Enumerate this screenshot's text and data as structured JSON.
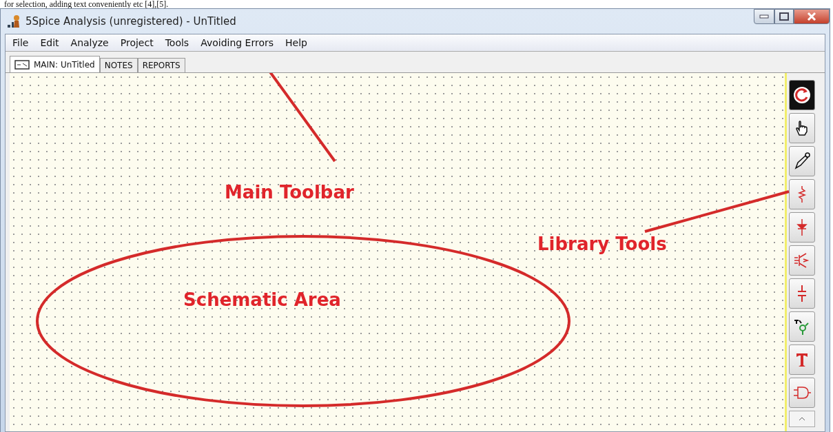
{
  "page_text": "for selection, adding text conveniently etc [4],[5].",
  "window": {
    "title": "5Spice Analysis (unregistered) - UnTitled"
  },
  "menu": [
    "File",
    "Edit",
    "Analyze",
    "Project",
    "Tools",
    "Avoiding Errors",
    "Help"
  ],
  "tabs": [
    {
      "label": "MAIN:  UnTitled",
      "selected": true
    },
    {
      "label": "NOTES",
      "selected": false
    },
    {
      "label": "REPORTS",
      "selected": false
    }
  ],
  "tools": [
    {
      "kind": "refresh",
      "selected": true
    },
    {
      "kind": "hand",
      "selected": false
    },
    {
      "kind": "probe",
      "selected": false
    },
    {
      "kind": "resistor",
      "selected": false
    },
    {
      "kind": "diode",
      "selected": false
    },
    {
      "kind": "transistor",
      "selected": false
    },
    {
      "kind": "capacitor",
      "selected": false
    },
    {
      "kind": "node",
      "selected": false
    },
    {
      "kind": "text",
      "selected": false
    },
    {
      "kind": "gate",
      "selected": false
    },
    {
      "kind": "scroll",
      "selected": false
    }
  ],
  "annotations": [
    {
      "kind": "arrow",
      "label": "Main Toolbar"
    },
    {
      "kind": "arrow",
      "label": "Library Tools"
    },
    {
      "kind": "ellipse",
      "label": "Schematic Area"
    }
  ]
}
